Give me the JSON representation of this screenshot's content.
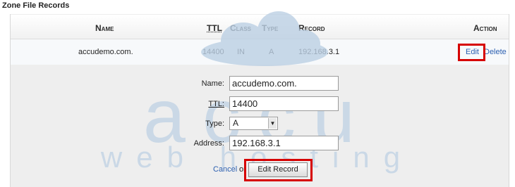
{
  "page": {
    "heading": "Zone File Records"
  },
  "table": {
    "columns": {
      "name": "Name",
      "ttl": "TTL",
      "class": "Class",
      "type": "Type",
      "record": "Record",
      "action": "Action"
    },
    "row": {
      "name": "accudemo.com.",
      "ttl": "14400",
      "class": "IN",
      "type": "A",
      "record": "192.168.3.1",
      "edit": "Edit",
      "delete": "Delete"
    }
  },
  "edit_form": {
    "name_label": "Name:",
    "name_value": "accudemo.com.",
    "ttl_label": "TTL:",
    "ttl_value": "14400",
    "type_label": "Type:",
    "type_value": "A",
    "address_label": "Address:",
    "address_value": "192.168.3.1",
    "cancel_label": "Cancel",
    "or_text": "or",
    "submit_label": "Edit Record"
  },
  "watermark": {
    "brand_top": "accu",
    "brand_bottom": "web hosting"
  },
  "colors": {
    "highlight": "#d60000",
    "link": "#2b5fb0",
    "watermark": "#bcd0e4"
  },
  "icons": {
    "select_arrow": "chevron-down-icon",
    "logo_cloud": "cloud-icon"
  }
}
